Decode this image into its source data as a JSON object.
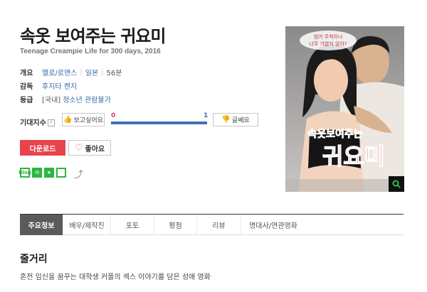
{
  "movie": {
    "title": "속옷 보여주는 귀요미",
    "original_title": "Teenage Creampie Life for 300 days, 2016"
  },
  "info": {
    "overview_label": "개요",
    "genre": "멜로/로맨스",
    "country": "일본",
    "runtime": "56분",
    "director_label": "감독",
    "director": "후지타 켄지",
    "rating_label": "등급",
    "rating_region": "[국내]",
    "rating": "청소년 관람불가"
  },
  "expectation": {
    "label": "기대지수",
    "help": "?",
    "want_label": "보고싶어요",
    "meh_label": "글쎄요",
    "want_count": "0",
    "meh_count": "1",
    "meh_ratio": 1.0,
    "want_color": "#e14450",
    "meh_color": "#3d72b5"
  },
  "actions": {
    "download_label": "다운로드",
    "like_label": "좋아요",
    "accent": "#e8434c"
  },
  "social": {
    "icons": [
      "blog-share-icon",
      "band-share-icon",
      "bookmark-star-icon",
      "green-square-icon"
    ],
    "blog_text": "Blog",
    "share_icon": "share-icon"
  },
  "poster": {
    "text_top_line1": "엄어 무척이나",
    "text_top_line2": "너무 가엾지 않아?",
    "text_main1": "속옷보여주는",
    "text_main2": "귀요미",
    "search_icon": "search-icon"
  },
  "tabs": [
    {
      "label": "주요정보",
      "active": true
    },
    {
      "label": "배우/제작진",
      "active": false
    },
    {
      "label": "포토",
      "active": false
    },
    {
      "label": "평점",
      "active": false
    },
    {
      "label": "리뷰",
      "active": false
    },
    {
      "label": "명대사/연관영화",
      "active": false
    }
  ],
  "synopsis": {
    "heading": "줄거리",
    "text": "혼전 임신을 꿈꾸는 대학생 커플의 섹스 이야기를 담은 성애 영화"
  }
}
